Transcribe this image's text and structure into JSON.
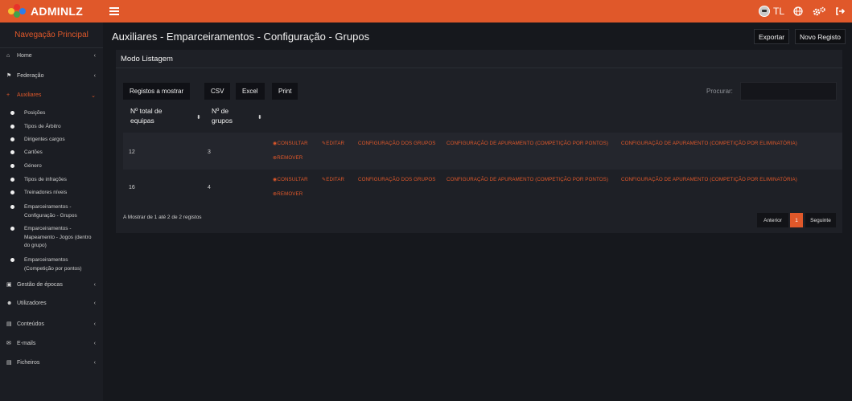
{
  "app": {
    "brand": "ADMINLZ",
    "user_initials": "TL"
  },
  "colors": {
    "accent": "#e0582a",
    "background": "#16181d",
    "sidebar": "#1b1d23",
    "card": "#1e2026"
  },
  "icons": {
    "menu": "hamburger-icon",
    "avatar": "avatar",
    "globe": "globe-icon",
    "settings": "cogs-icon",
    "logout": "sign-out-icon"
  },
  "sidebar": {
    "title": "Navegação Principal",
    "items": [
      {
        "label": "Home",
        "icon": "home-icon"
      },
      {
        "label": "Federação",
        "icon": "flag-icon"
      },
      {
        "label": "Auxiliares",
        "icon": "plus-icon",
        "active": true
      },
      {
        "label": "Gestão de épocas",
        "icon": "calendar-icon"
      },
      {
        "label": "Utilizadores",
        "icon": "users-icon"
      },
      {
        "label": "Conteúdos",
        "icon": "file-icon"
      },
      {
        "label": "E-mails",
        "icon": "envelope-icon"
      },
      {
        "label": "Ficheiros",
        "icon": "folder-icon"
      }
    ],
    "subitems": [
      "Posições",
      "Tipos de Árbitro",
      "Dirigentes cargos",
      "Cartões",
      "Género",
      "Tipos de infrações",
      "Treinadores níveis",
      "Emparceiramentos - Configuração - Grupos",
      "Emparceiramentos - Mapeamento - Jogos (dentro do grupo)",
      "Emparceiramentos (Competição por pontos)"
    ]
  },
  "header": {
    "title": "Auxiliares - Emparceiramentos - Configuração - Grupos",
    "export_label": "Exportar",
    "new_label": "Novo Registo"
  },
  "card": {
    "title": "Modo Listagem"
  },
  "toolbar": {
    "show": "Registos a mostrar",
    "csv": "CSV",
    "excel": "Excel",
    "print": "Print",
    "search_label": "Procurar:",
    "search_value": ""
  },
  "table": {
    "columns": [
      "Nº total de equipas",
      "Nº de grupos"
    ],
    "sort_icon": "sort-icon",
    "rows": [
      {
        "total": "12",
        "grupos": "3"
      },
      {
        "total": "16",
        "grupos": "4"
      }
    ],
    "actions": {
      "consultar": "CONSULTAR",
      "editar": "EDITAR",
      "config_grupos": "CONFIGURAÇÃO DOS GRUPOS",
      "config_pontos": "CONFIGURAÇÃO DE APURAMENTO (COMPETIÇÃO POR PONTOS)",
      "config_elim": "CONFIGURAÇÃO DE APURAMENTO (COMPETIÇÃO POR ELIMINATÓRIA)",
      "remover": "REMOVER"
    }
  },
  "pagination": {
    "info": "A Mostrar de 1 até 2 de 2 registos",
    "prev": "Anterior",
    "current": "1",
    "next": "Seguinte"
  }
}
